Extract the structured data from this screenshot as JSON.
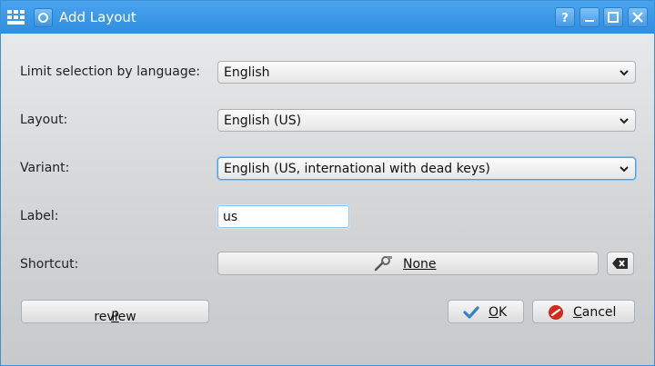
{
  "window": {
    "title": "Add Layout",
    "icons": [
      "keyboard-icon",
      "pin-icon"
    ],
    "titlebar_buttons": [
      "help-icon",
      "minimize-icon",
      "maximize-icon",
      "close-icon"
    ]
  },
  "form": {
    "language_label": "Limit selection by language:",
    "language_value": "English",
    "layout_label": "Layout:",
    "layout_value": "English (US)",
    "variant_label": "Variant:",
    "variant_value": "English (US, international with dead keys)",
    "label_label": "Label:",
    "label_value": "us",
    "shortcut_label": "Shortcut:",
    "shortcut_value": "None",
    "shortcut_icon": "key-wrench-icon",
    "clear_icon": "clear-backspace-icon"
  },
  "buttons": {
    "preview_first": "P",
    "preview_rest": "review",
    "ok_first": "O",
    "ok_rest": "K",
    "cancel_first": "C",
    "cancel_rest": "ancel",
    "ok_icon": "checkmark-icon",
    "cancel_icon": "cancel-icon"
  },
  "colors": {
    "titlebar": "#3a98e6",
    "accent_focus": "#4aa0e8",
    "ok_check": "#3b7fc4",
    "cancel_red": "#d42a1a"
  }
}
